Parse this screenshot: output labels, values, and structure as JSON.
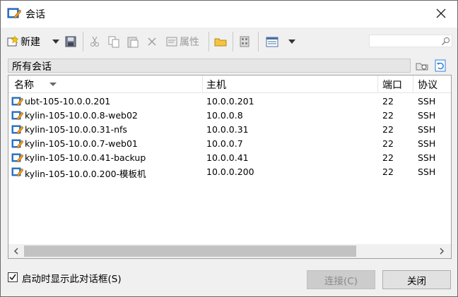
{
  "window": {
    "title": "会话"
  },
  "toolbar": {
    "new_label": "新建",
    "properties_label": "属性"
  },
  "search": {
    "value": "",
    "placeholder": ""
  },
  "folder": {
    "path": "所有会话"
  },
  "columns": {
    "name": "名称",
    "host": "主机",
    "port": "端口",
    "protocol": "协议"
  },
  "sessions": [
    {
      "name": "ubt-105-10.0.0.201",
      "host": "10.0.0.201",
      "port": "22",
      "protocol": "SSH"
    },
    {
      "name": "kylin-105-10.0.0.8-web02",
      "host": "10.0.0.8",
      "port": "22",
      "protocol": "SSH"
    },
    {
      "name": "kylin-105-10.0.0.31-nfs",
      "host": "10.0.0.31",
      "port": "22",
      "protocol": "SSH"
    },
    {
      "name": "kylin-105-10.0.0.7-web01",
      "host": "10.0.0.7",
      "port": "22",
      "protocol": "SSH"
    },
    {
      "name": "kylin-105-10.0.0.41-backup",
      "host": "10.0.0.41",
      "port": "22",
      "protocol": "SSH"
    },
    {
      "name": "kylin-105-10.0.0.200-模板机",
      "host": "10.0.0.200",
      "port": "22",
      "protocol": "SSH"
    }
  ],
  "footer": {
    "show_on_startup_label": "启动时显示此对话框(S)",
    "show_on_startup_checked": true,
    "connect_label": "连接(C)",
    "close_label": "关闭"
  },
  "colors": {
    "accent": "#1e6fd9",
    "disabled_text": "#8a8a8a"
  }
}
